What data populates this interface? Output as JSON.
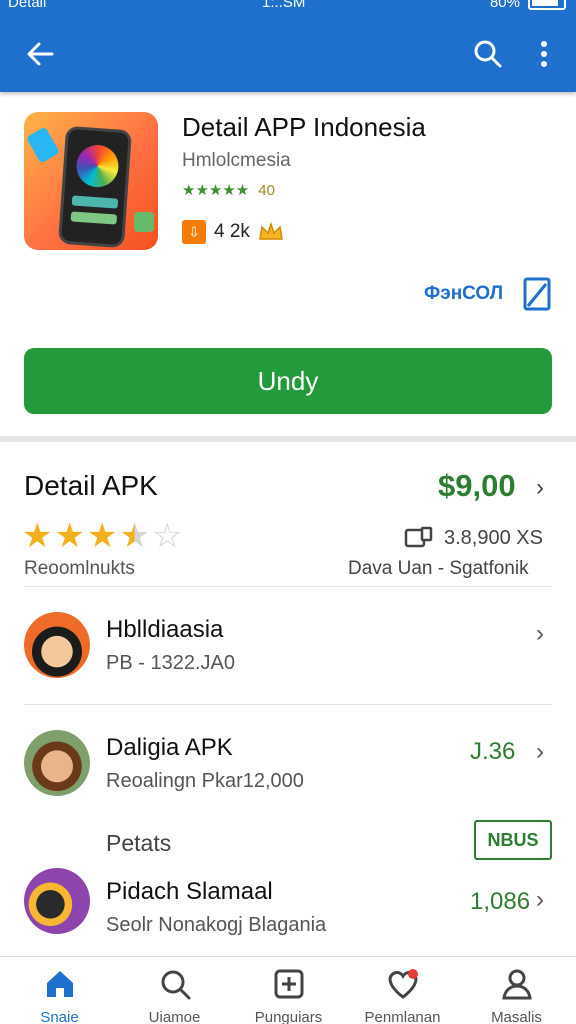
{
  "status_bar": {
    "left": "Detail",
    "time": "1:..SM",
    "battery": "80%"
  },
  "app_bar": {
    "back_icon": "arrow-left-icon",
    "search_icon": "search-icon",
    "more_icon": "more-vert-icon"
  },
  "app": {
    "title": "Detail APP Indonesia",
    "developer": "Hmlolcmesia",
    "rating_text": "40",
    "downloads": "4 2k",
    "wishlist_label": "ФэнСОЛ",
    "install_label": "Undy"
  },
  "detail": {
    "title": "Detail APK",
    "price": "$9,00",
    "rating": 3.5,
    "reviews": "3.8,900 XS",
    "sub_left": "Reoomlnukts",
    "sub_right": "Dava Uan - Sgatfonik"
  },
  "items": [
    {
      "title": "Hblldiaasia",
      "subtitle": "PB - 1322.JA0",
      "value": ""
    },
    {
      "title": "Daligia APK",
      "subtitle": "Reoalingn Pkar12,000",
      "value": "J.36"
    },
    {
      "title": "Pidach Slamaal",
      "subtitle": "Seolr Nonakogj Blagania",
      "value": "1,086"
    }
  ],
  "section_label": "Petats",
  "badge": "NBUS",
  "bottom_nav": [
    {
      "label": "Snaie",
      "icon": "home-icon"
    },
    {
      "label": "Uiamoe",
      "icon": "search-icon"
    },
    {
      "label": "Punguiars",
      "icon": "plus-square-icon"
    },
    {
      "label": "Penmlanan",
      "icon": "heart-icon"
    },
    {
      "label": "Masalis",
      "icon": "profile-icon"
    }
  ],
  "colors": {
    "primary": "#1f6fcc",
    "install": "#239a3b",
    "accent_green": "#2e7d32",
    "star": "#f2b01e"
  }
}
